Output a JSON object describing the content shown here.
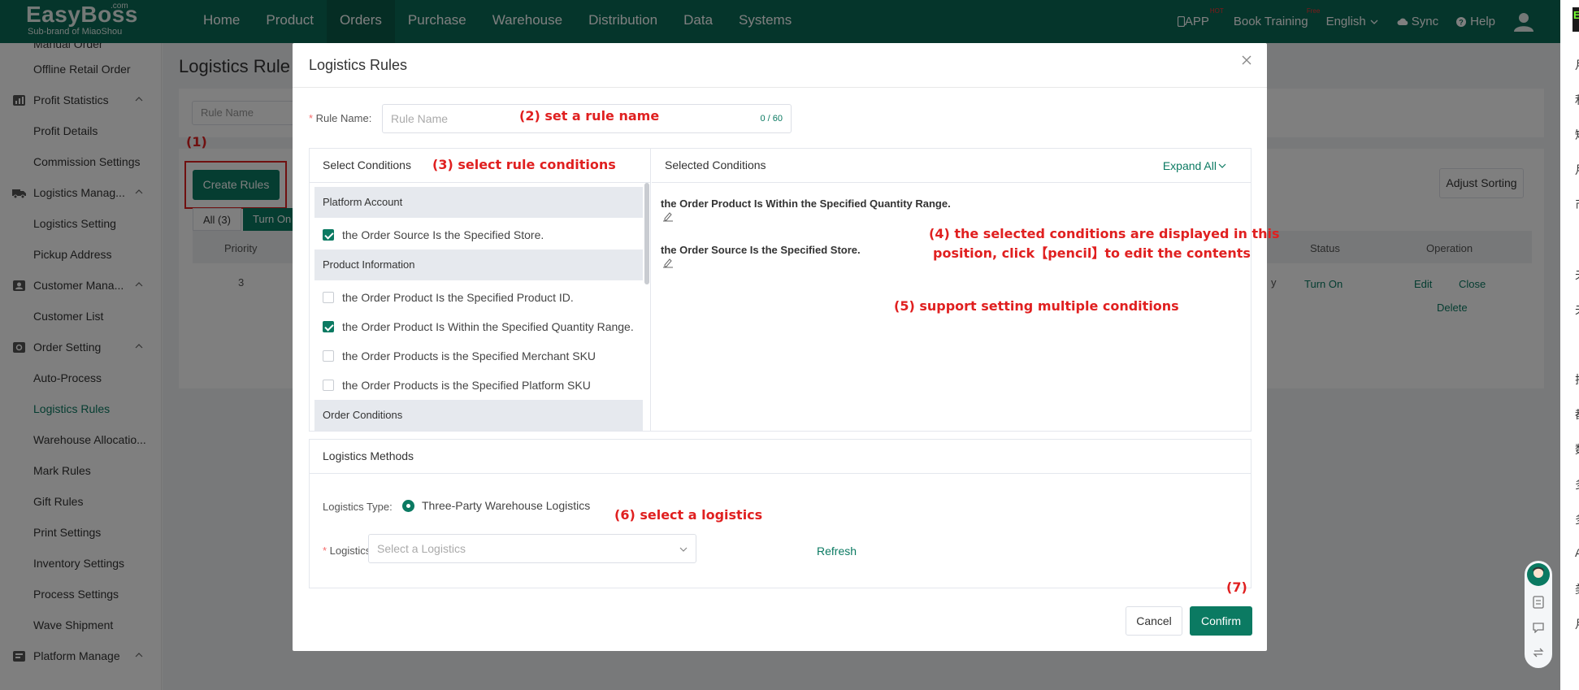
{
  "brand": {
    "name": "EasyBoss",
    "com": ".com",
    "sub": "Sub-brand of MiaoShou"
  },
  "nav": [
    "Home",
    "Product",
    "Orders",
    "Purchase",
    "Warehouse",
    "Distribution",
    "Data",
    "Systems"
  ],
  "nav_active": "Orders",
  "topright": {
    "app": "APP",
    "app_badge": "HOT",
    "training": "Book Training",
    "training_badge": "Free",
    "language": "English",
    "sync": "Sync",
    "help": "Help"
  },
  "sidebar": {
    "partial_item": "Manual Order",
    "items_top": [
      "Offline Retail Order"
    ],
    "groups": [
      {
        "label": "Profit Statistics",
        "icon": "chart-icon",
        "items": [
          "Profit Details",
          "Commission Settings"
        ]
      },
      {
        "label": "Logistics Manag...",
        "icon": "truck-icon",
        "items": [
          "Logistics Setting",
          "Pickup Address"
        ]
      },
      {
        "label": "Customer Mana...",
        "icon": "customer-icon",
        "items": [
          "Customer List"
        ]
      },
      {
        "label": "Order Setting",
        "icon": "order-setting-icon",
        "items": [
          "Auto-Process",
          "Logistics Rules",
          "Warehouse Allocatio...",
          "Mark Rules",
          "Gift Rules",
          "Print Settings",
          "Inventory Settings",
          "Process Settings",
          "Wave Shipment"
        ]
      },
      {
        "label": "Platform Manage",
        "icon": "platform-icon",
        "items": []
      }
    ],
    "active_item": "Logistics Rules"
  },
  "background_page": {
    "title": "Logistics Rule",
    "rule_name_placeholder": "Rule Name",
    "create_button": "Create Rules",
    "adjust_sorting": "Adjust Sorting",
    "tabs": [
      "All (3)",
      "Turn On"
    ],
    "table_headers": {
      "priority": "Priority",
      "status": "Status",
      "operation": "Operation"
    },
    "row": {
      "priority": "3",
      "status": "Turn On",
      "edit": "Edit",
      "close": "Close",
      "delete": "Delete",
      "clip": "y"
    }
  },
  "modal": {
    "title": "Logistics Rules",
    "rule_name_label": "Rule Name:",
    "rule_name_placeholder": "Rule Name",
    "rule_name_counter": "0 / 60",
    "select_conditions_title": "Select Conditions",
    "selected_conditions_title": "Selected Conditions",
    "expand_all": "Expand All",
    "groups": {
      "platform_account": "Platform Account",
      "product_information": "Product Information",
      "order_conditions": "Order Conditions"
    },
    "conditions": {
      "order_source_store": {
        "label": "the Order Source Is the Specified Store.",
        "checked": true
      },
      "product_id": {
        "label": "the Order Product Is the Specified Product ID.",
        "checked": false
      },
      "quantity_range": {
        "label": "the Order Product Is Within the Specified Quantity Range.",
        "checked": true
      },
      "merchant_sku": {
        "label": "the Order Products is the Specified Merchant SKU",
        "checked": false
      },
      "platform_sku": {
        "label": "the Order Products is the Specified Platform SKU",
        "checked": false
      }
    },
    "selected": [
      "the Order Product Is Within the Specified Quantity Range.",
      "the Order Source Is the Specified Store."
    ],
    "logistics_methods_title": "Logistics Methods",
    "logistics_type_label": "Logistics Type:",
    "logistics_type_value": "Three-Party Warehouse Logistics",
    "logistics_label": "Logistics:",
    "logistics_placeholder": "Select a Logistics",
    "refresh": "Refresh",
    "cancel": "Cancel",
    "confirm": "Confirm"
  },
  "annotations": {
    "a1": "(1)",
    "a2": "(2) set a rule name",
    "a3": "(3) select rule conditions",
    "a4_line1": "(4) the selected conditions are displayed in this",
    "a4_line2": "position, click【pencil】to edit the contents",
    "a5": "(5) support setting multiple conditions",
    "a6": "(6) select a logistics",
    "a7": "(7)"
  },
  "right_strip_chars": [
    "月",
    "利",
    "短",
    "月",
    "币",
    "E",
    "夫",
    "夫",
    "拉",
    "都",
    "数",
    "多",
    "多",
    "A",
    "美",
    "月"
  ],
  "colors": {
    "brand": "#0b6b57",
    "accent": "#0b7a62",
    "annotation": "#e02020"
  }
}
